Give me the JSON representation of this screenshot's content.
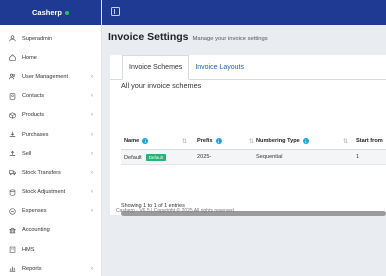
{
  "brand": {
    "name": "Casherp"
  },
  "sidebar": {
    "items": [
      {
        "label": "Superadmin",
        "icon": "user-icon",
        "chev": ""
      },
      {
        "label": "Home",
        "icon": "home-icon",
        "chev": ""
      },
      {
        "label": "User Management",
        "icon": "users-icon",
        "chev": "‹"
      },
      {
        "label": "Contacts",
        "icon": "contacts-icon",
        "chev": "‹"
      },
      {
        "label": "Products",
        "icon": "box-icon",
        "chev": "‹"
      },
      {
        "label": "Purchases",
        "icon": "download-icon",
        "chev": "‹"
      },
      {
        "label": "Sell",
        "icon": "upload-icon",
        "chev": "‹"
      },
      {
        "label": "Stock Transfers",
        "icon": "truck-icon",
        "chev": "‹"
      },
      {
        "label": "Stock Adjustment",
        "icon": "database-icon",
        "chev": "‹"
      },
      {
        "label": "Expenses",
        "icon": "minus-circle-icon",
        "chev": "‹"
      },
      {
        "label": "Accounting",
        "icon": "bank-icon",
        "chev": ""
      },
      {
        "label": "HMS",
        "icon": "hotel-icon",
        "chev": ""
      },
      {
        "label": "Reports",
        "icon": "chart-icon",
        "chev": "‹"
      }
    ]
  },
  "header": {
    "title": "Invoice Settings",
    "subtitle": "Manage your invoice settings"
  },
  "tabs": [
    {
      "label": "Invoice Schemes"
    },
    {
      "label": "Invoice Layouts"
    }
  ],
  "content": {
    "heading": "All your invoice schemes",
    "columns": [
      "Name",
      "Prefix",
      "Numbering Type",
      "Start from"
    ],
    "rows": [
      {
        "name": "Default",
        "badge": "Default",
        "prefix": "2025-",
        "numbering_type": "Sequential",
        "start_from": "1"
      }
    ],
    "entries_info": "Showing 1 to 1 of 1 entries"
  },
  "footer": {
    "text": "Casherp - V6.5 | Copyright © 2025 All rights reserved."
  },
  "colors": {
    "brand": "#1f3a93",
    "accent": "#1f63b8",
    "badge": "#22b573",
    "info": "#1aa3d9"
  }
}
